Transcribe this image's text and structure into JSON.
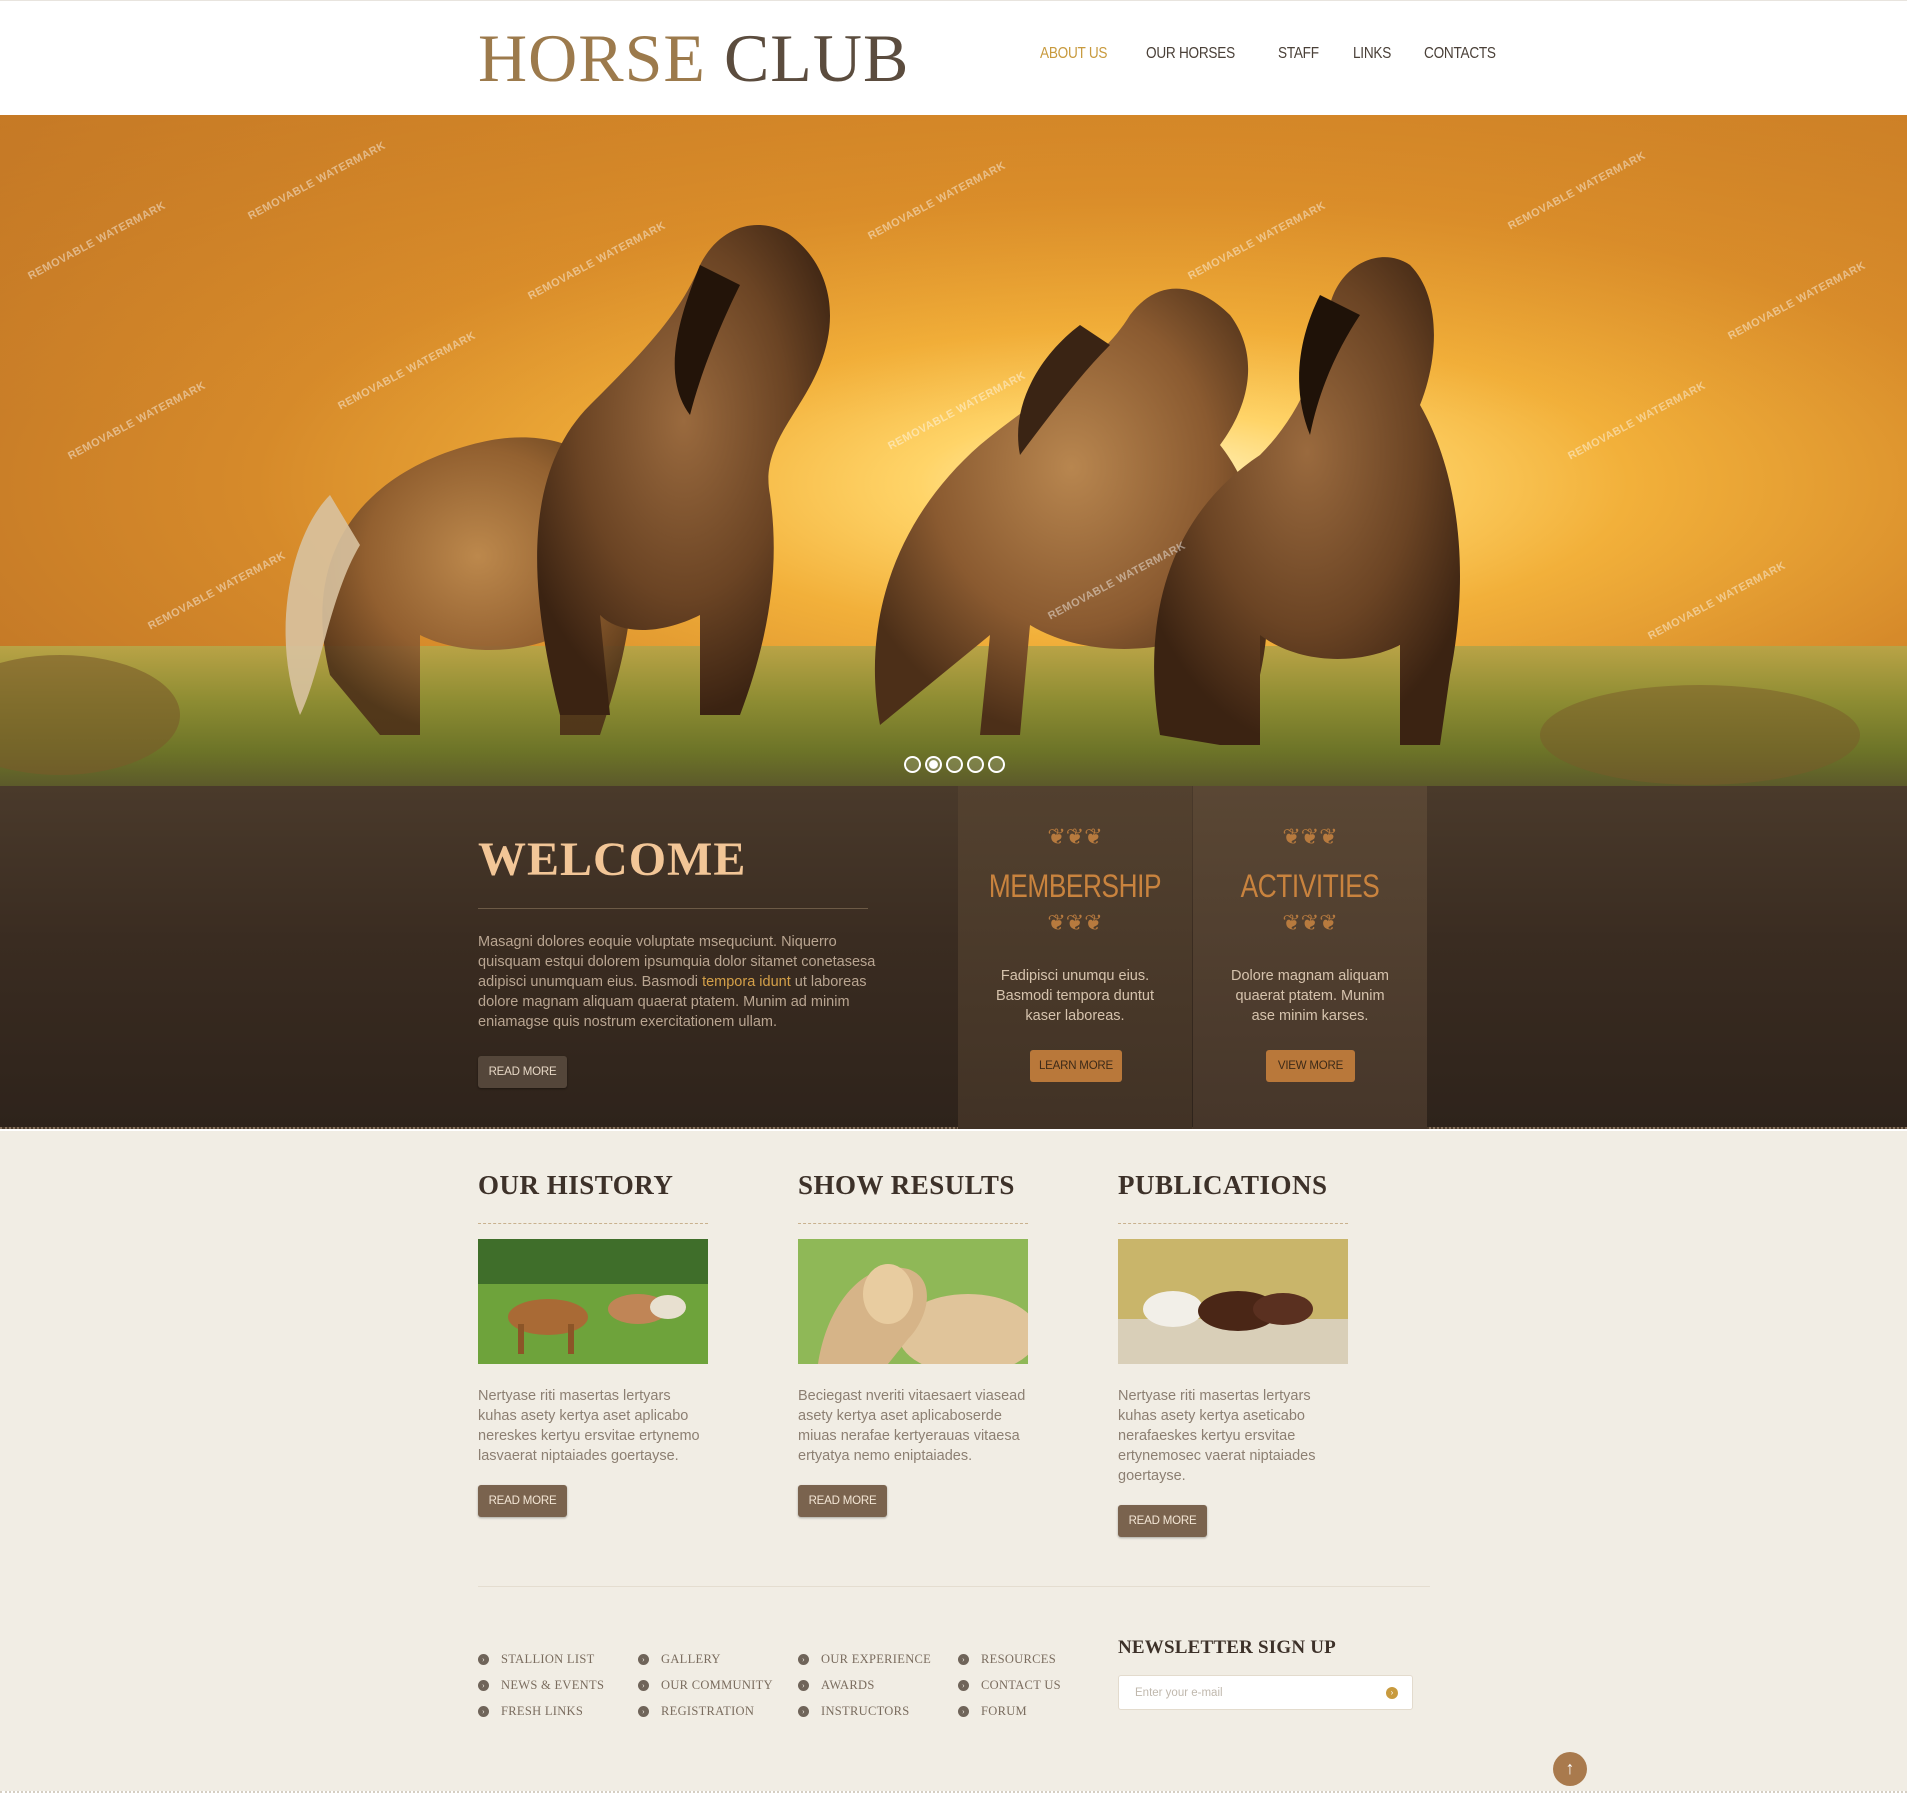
{
  "header": {
    "logo_word1": "HORSE",
    "logo_word2": "CLUB",
    "nav": [
      {
        "label": "ABOUT US",
        "active": true
      },
      {
        "label": "OUR HORSES",
        "active": false
      },
      {
        "label": "STAFF",
        "active": false
      },
      {
        "label": "LINKS",
        "active": false
      },
      {
        "label": "CONTACTS",
        "active": false
      }
    ]
  },
  "hero": {
    "watermark": "REMOVABLE WATERMARK",
    "slides": 5,
    "active_slide": 2
  },
  "welcome": {
    "title": "WELCOME",
    "text_before": "Masagni dolores eoquie voluptate msequciunt. Niquerro quisquam estqui dolorem ipsumquia dolor sitamet conetasesa adipisci unumquam eius. Basmodi ",
    "highlight": "tempora idunt",
    "text_after": " ut laboreas dolore magnam aliquam quaerat ptatem. Munim ad minim eniamagse quis nostrum exercitationem ullam.",
    "button": "READ MORE"
  },
  "panels": [
    {
      "title": "MEMBERSHIP",
      "text": "Fadipisci unumqu eius. Basmodi tempora duntut kaser laboreas.",
      "button": "LEARN MORE"
    },
    {
      "title": "ACTIVITIES",
      "text": "Dolore magnam aliquam quaerat ptatem. Munim ase minim karses.",
      "button": "VIEW MORE"
    }
  ],
  "columns": [
    {
      "title": "OUR HISTORY",
      "text": "Nertyase riti masertas lertyars kuhas asety kertya aset aplicabo nereskes kertyu ersvitae ertynemo lasvaerat niptaiades goertayse.",
      "button": "READ MORE"
    },
    {
      "title": "SHOW RESULTS",
      "text": "Beciegast nveriti vitaesaert viasead asety kertya aset aplicaboserde miuas nerafae kertyerauas vitaesa ertyatya nemo eniptaiades.",
      "button": "READ MORE"
    },
    {
      "title": "PUBLICATIONS",
      "text": "Nertyase riti masertas lertyars kuhas asety kertya aseticabo nerafaeskes kertyu ersvitae ertynemosec vaerat niptaiades goertayse.",
      "button": "READ MORE"
    }
  ],
  "footer": {
    "link_columns": [
      [
        "STALLION LIST",
        "NEWS & EVENTS",
        "FRESH LINKS"
      ],
      [
        "GALLERY",
        "OUR COMMUNITY",
        "REGISTRATION"
      ],
      [
        "OUR EXPERIENCE",
        "AWARDS",
        "INSTRUCTORS"
      ],
      [
        "RESOURCES",
        "CONTACT US",
        "FORUM"
      ]
    ],
    "newsletter_title": "NEWSLETTER SIGN UP",
    "newsletter_placeholder": "Enter your e-mail"
  },
  "colors": {
    "accent_gold": "#c89a3e",
    "dark_band": "#3a2c21",
    "panel_title": "#c9833e",
    "page_bg": "#f1ede4"
  }
}
